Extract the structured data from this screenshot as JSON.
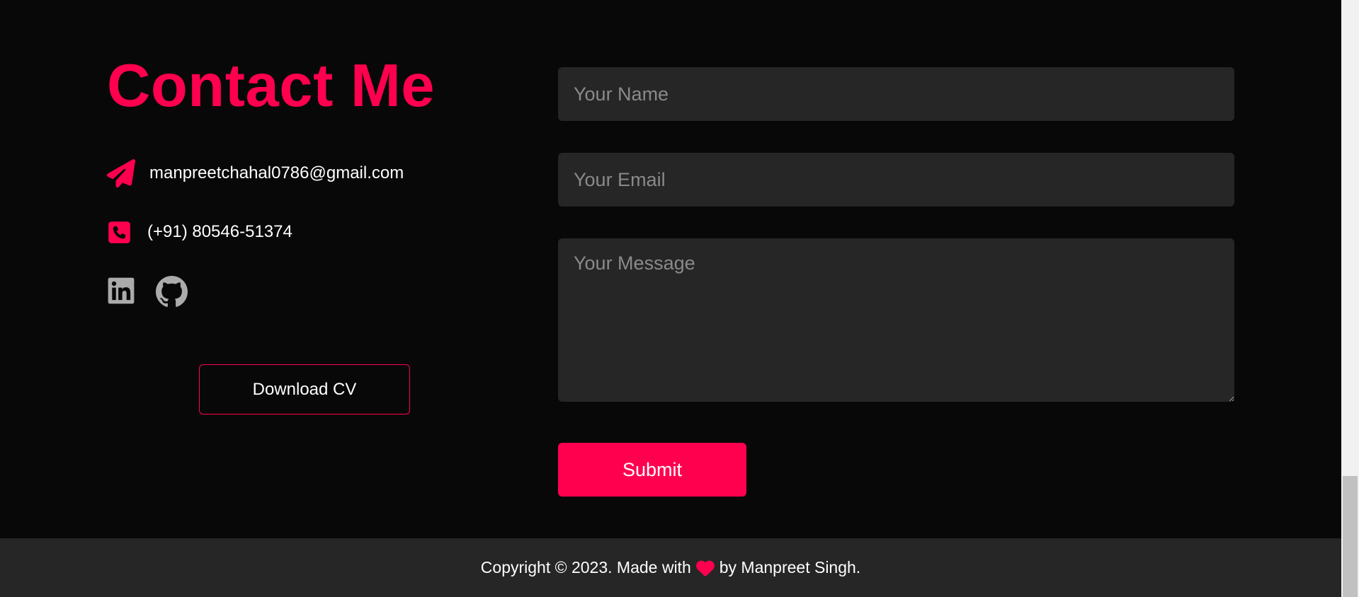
{
  "contact": {
    "title": "Contact Me",
    "email": "manpreetchahal0786@gmail.com",
    "phone": "(+91) 80546-51374",
    "download_cv_label": "Download CV",
    "icons": {
      "email": "paper-plane-icon",
      "phone": "phone-square-icon",
      "social": [
        "linkedin-icon",
        "github-icon"
      ]
    }
  },
  "form": {
    "name_placeholder": "Your Name",
    "email_placeholder": "Your Email",
    "message_placeholder": "Your Message",
    "submit_label": "Submit"
  },
  "footer": {
    "text_before": "Copyright © 2023. Made with",
    "heart_icon": "heart-icon",
    "text_after": "by Manpreet Singh."
  },
  "colors": {
    "accent": "#ff004f",
    "background": "#080808",
    "surface": "#262626",
    "text": "#ffffff",
    "placeholder": "#8a8a8a",
    "social_icon": "#ababab"
  }
}
